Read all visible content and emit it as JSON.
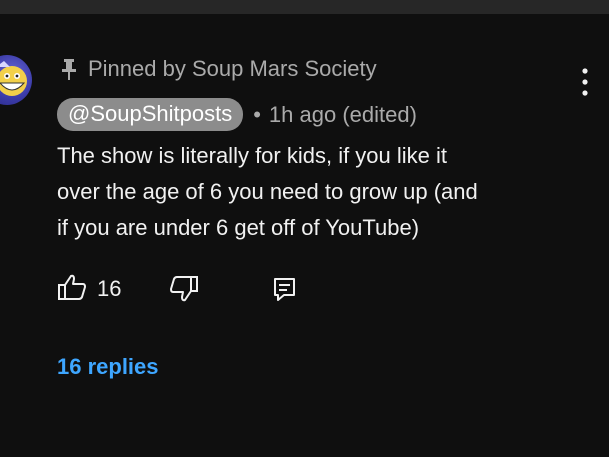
{
  "colors": {
    "background": "#0f0f0f",
    "text": "#f1f1f1",
    "muted": "#aaaaaa",
    "handle_chip": "#8c8c8c",
    "link": "#3ea6ff"
  },
  "comment": {
    "avatar_icon": "channel-avatar-icon",
    "pinned_icon": "pin-icon",
    "pinned_label": "Pinned by Soup Mars Society",
    "menu_icon": "more-vert-icon",
    "author": "@SoupShitposts",
    "separator": "•",
    "timestamp": "1h ago (edited)",
    "text": "The show is literally for kids, if you like it\nover the age of 6 you need to grow up (and\nif you are under 6 get off of YouTube)",
    "like_icon": "thumbs-up-icon",
    "like_count": "16",
    "dislike_icon": "thumbs-down-icon",
    "reply_icon": "reply-icon",
    "replies_label": "16 replies"
  }
}
